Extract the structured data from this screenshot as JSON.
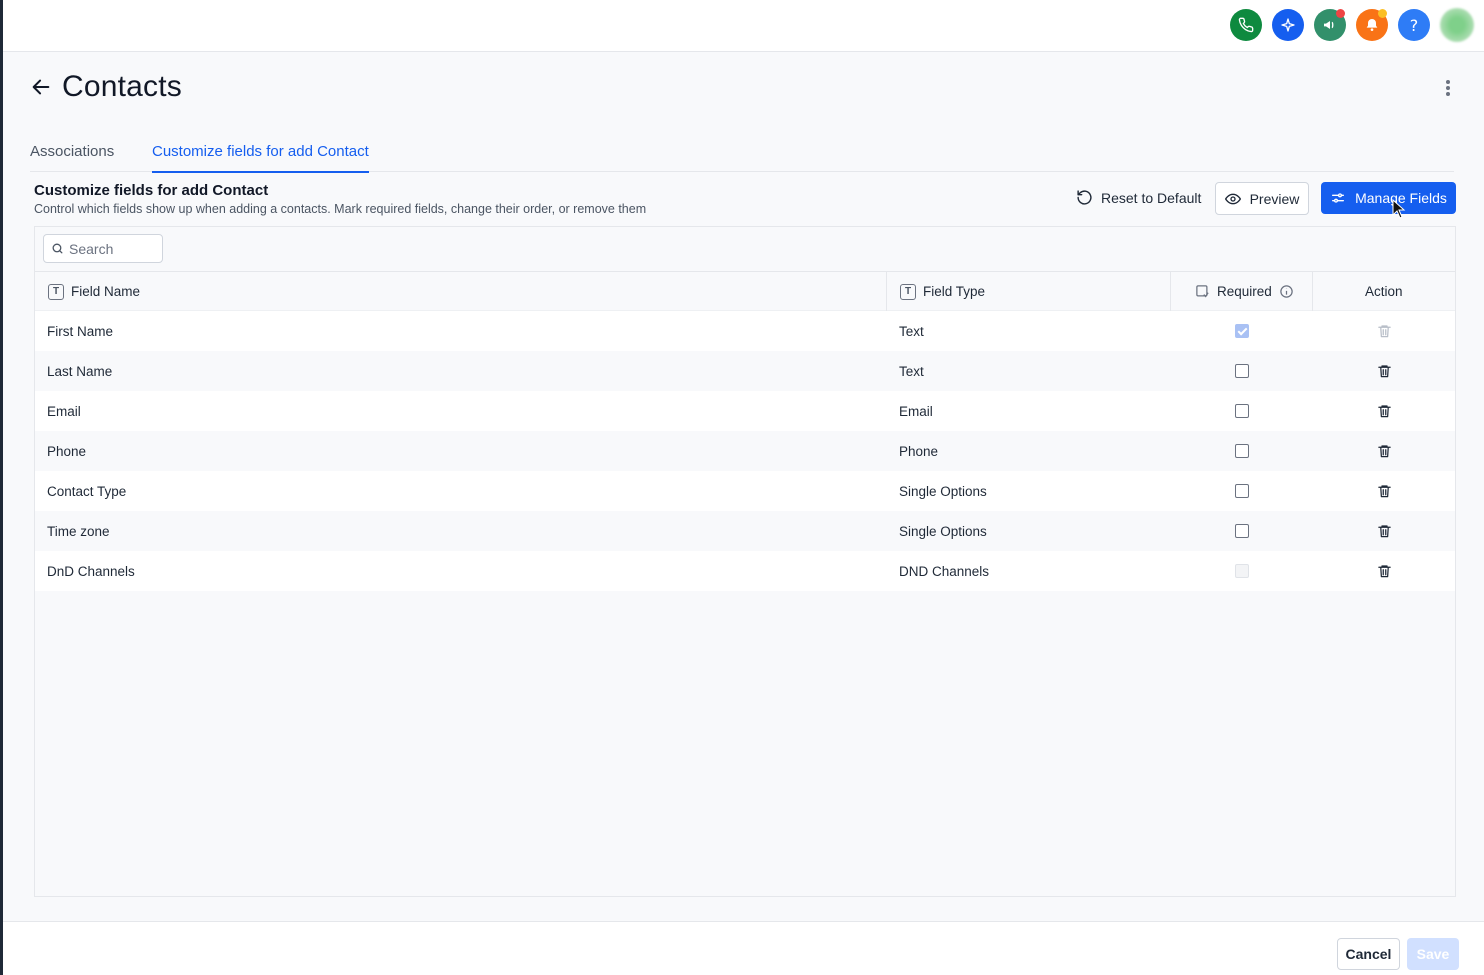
{
  "topbar": {
    "icons": [
      {
        "name": "phone-icon",
        "color": "#0e8a3f"
      },
      {
        "name": "sparkle-icon",
        "color": "#155eef"
      },
      {
        "name": "megaphone-icon",
        "color": "#32906b",
        "badge": "#ef4444"
      },
      {
        "name": "bell-icon",
        "color": "#f97316",
        "badge": "#fbbf24"
      },
      {
        "name": "help-icon",
        "color": "#2e7cf6",
        "glyph": "?"
      }
    ]
  },
  "header": {
    "title": "Contacts"
  },
  "tabs": [
    {
      "label": "Associations",
      "active": false
    },
    {
      "label": "Customize fields for add Contact",
      "active": true
    }
  ],
  "section": {
    "title": "Customize fields for add Contact",
    "description": "Control which fields show up when adding a contacts. Mark required fields, change their order, or remove them",
    "reset_label": "Reset to Default",
    "preview_label": "Preview",
    "manage_label": "Manage Fields"
  },
  "search": {
    "placeholder": "Search"
  },
  "table": {
    "columns": {
      "name": "Field Name",
      "type": "Field Type",
      "required": "Required",
      "action": "Action"
    },
    "rows": [
      {
        "name": "First Name",
        "type": "Text",
        "required": true,
        "locked": true
      },
      {
        "name": "Last Name",
        "type": "Text",
        "required": false,
        "locked": false
      },
      {
        "name": "Email",
        "type": "Email",
        "required": false,
        "locked": false
      },
      {
        "name": "Phone",
        "type": "Phone",
        "required": false,
        "locked": false
      },
      {
        "name": "Contact Type",
        "type": "Single Options",
        "required": false,
        "locked": false
      },
      {
        "name": "Time zone",
        "type": "Single Options",
        "required": false,
        "locked": false
      },
      {
        "name": "DnD Channels",
        "type": "DND Channels",
        "required": false,
        "locked": true
      }
    ]
  },
  "footer": {
    "cancel_label": "Cancel",
    "save_label": "Save"
  }
}
